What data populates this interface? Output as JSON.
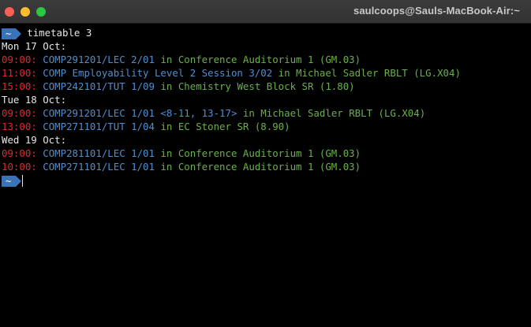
{
  "window": {
    "title": "saulcoops@Sauls-MacBook-Air:~",
    "colors": {
      "close": "#fe5f57",
      "minimize": "#febc2e",
      "maximize": "#28c840",
      "background": "#000000"
    }
  },
  "prompt": {
    "symbol": "~",
    "command": "timetable 3"
  },
  "days": [
    {
      "header": "Mon 17 Oct:",
      "entries": [
        {
          "time": "09:00:",
          "code": "COMP291201/LEC 2/01",
          "weeks": "",
          "in": "in",
          "location": "Conference Auditorium 1 (GM.03)"
        },
        {
          "time": "11:00:",
          "code": "COMP Employability Level 2 Session 3/02",
          "weeks": "",
          "in": "in",
          "location": "Michael Sadler RBLT (LG.X04)"
        },
        {
          "time": "15:00:",
          "code": "COMP242101/TUT 1/09",
          "weeks": "",
          "in": "in",
          "location": "Chemistry West Block SR (1.80)"
        }
      ]
    },
    {
      "header": "Tue 18 Oct:",
      "entries": [
        {
          "time": "09:00:",
          "code": "COMP291201/LEC 1/01",
          "weeks": "<8-11, 13-17>",
          "in": "in",
          "location": "Michael Sadler RBLT (LG.X04)"
        },
        {
          "time": "13:00:",
          "code": "COMP271101/TUT 1/04",
          "weeks": "",
          "in": "in",
          "location": "EC Stoner SR (8.90)"
        }
      ]
    },
    {
      "header": "Wed 19 Oct:",
      "entries": [
        {
          "time": "09:00:",
          "code": "COMP281101/LEC 1/01",
          "weeks": "",
          "in": "in",
          "location": "Conference Auditorium 1 (GM.03)"
        },
        {
          "time": "10:00:",
          "code": "COMP271101/LEC 1/01",
          "weeks": "",
          "in": "in",
          "location": "Conference Auditorium 1 (GM.03)"
        }
      ]
    }
  ],
  "end_prompt": {
    "symbol": "~"
  }
}
